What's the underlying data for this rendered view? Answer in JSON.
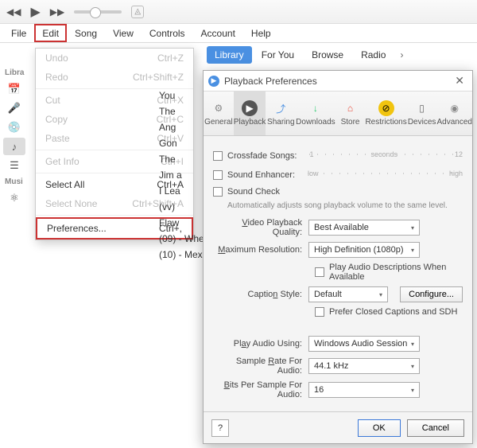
{
  "menubar": {
    "items": [
      "File",
      "Edit",
      "Song",
      "View",
      "Controls",
      "Account",
      "Help"
    ],
    "highlighted": "Edit"
  },
  "tabs": {
    "items": [
      "Library",
      "For You",
      "Browse",
      "Radio"
    ],
    "active": "Library"
  },
  "sidebar": {
    "heading1": "Libra",
    "heading2": "Musi"
  },
  "edit_menu": {
    "items": [
      {
        "label": "Undo",
        "shortcut": "Ctrl+Z",
        "disabled": true
      },
      {
        "label": "Redo",
        "shortcut": "Ctrl+Shift+Z",
        "disabled": true
      },
      {
        "sep": true
      },
      {
        "label": "Cut",
        "shortcut": "Ctrl+X",
        "disabled": true
      },
      {
        "label": "Copy",
        "shortcut": "Ctrl+C",
        "disabled": true
      },
      {
        "label": "Paste",
        "shortcut": "Ctrl+V",
        "disabled": true
      },
      {
        "sep": true
      },
      {
        "label": "Get Info",
        "shortcut": "Ctrl+I",
        "disabled": true
      },
      {
        "sep": true
      },
      {
        "label": "Select All",
        "shortcut": "Ctrl+A"
      },
      {
        "label": "Select None",
        "shortcut": "Ctrl+Shift+A",
        "disabled": true
      },
      {
        "sep": true
      },
      {
        "label": "Preferences...",
        "shortcut": "Ctrl+,",
        "highlight": true
      }
    ]
  },
  "songs": {
    "partial": [
      "You",
      "The",
      "Ang",
      "Gon",
      "The",
      "Jim a",
      "I Lea",
      "Flaw"
    ],
    "full": [
      "(09) - Whe",
      "(10) - Mex"
    ],
    "truncated_marker": "(vv)"
  },
  "dialog": {
    "title": "Playback Preferences",
    "tabs": [
      "General",
      "Playback",
      "Sharing",
      "Downloads",
      "Store",
      "Restrictions",
      "Devices",
      "Advanced"
    ],
    "active_tab": "Playback",
    "crossfade": {
      "label": "Crossfade Songs:",
      "min": "1",
      "unit": "seconds",
      "max": "12"
    },
    "enhancer": {
      "label": "Sound Enhancer:",
      "low": "low",
      "high": "high"
    },
    "soundcheck": {
      "label": "Sound Check",
      "note": "Automatically adjusts song playback volume to the same level."
    },
    "video_quality": {
      "label": "Video Playback Quality:",
      "value": "Best Available"
    },
    "max_res": {
      "label": "Maximum Resolution:",
      "value": "High Definition (1080p)"
    },
    "play_audio_desc": "Play Audio Descriptions When Available",
    "caption": {
      "label": "Caption Style:",
      "value": "Default",
      "config": "Configure..."
    },
    "prefer_cc": "Prefer Closed Captions and SDH",
    "play_using": {
      "label": "Play Audio Using:",
      "value": "Windows Audio Session"
    },
    "sample_rate": {
      "label": "Sample Rate For Audio:",
      "value": "44.1 kHz"
    },
    "bits": {
      "label": "Bits Per Sample For Audio:",
      "value": "16"
    },
    "buttons": {
      "ok": "OK",
      "cancel": "Cancel",
      "help": "?"
    }
  }
}
